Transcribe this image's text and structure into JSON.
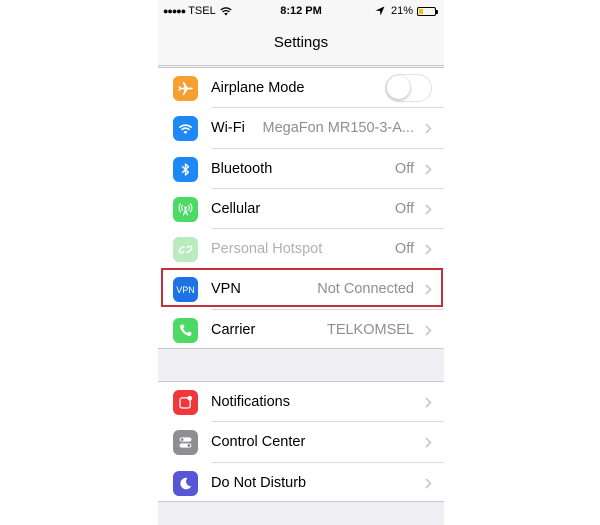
{
  "status_bar": {
    "signal": "●●●●●",
    "carrier": "TSEL",
    "time": "8:12 PM",
    "battery": "21%",
    "battery_level": 0.21
  },
  "nav": {
    "title": "Settings"
  },
  "colors": {
    "airplane": "#f7a032",
    "wifi": "#1e88f5",
    "bluetooth": "#1e88f5",
    "cellular": "#4cd964",
    "hotspot": "#b9ebbf",
    "vpn": "#1e72e8",
    "carrier": "#4cd964",
    "notifications": "#f0383a",
    "control_center": "#8e8e93",
    "dnd": "#5856d6",
    "highlight": "#c5303a"
  },
  "group1": [
    {
      "label": "Airplane Mode",
      "icon": "airplane-icon",
      "toggle": false
    },
    {
      "label": "Wi-Fi",
      "value": "MegaFon MR150-3-A...",
      "icon": "wifi-icon"
    },
    {
      "label": "Bluetooth",
      "value": "Off",
      "icon": "bluetooth-icon"
    },
    {
      "label": "Cellular",
      "value": "Off",
      "icon": "cellular-icon"
    },
    {
      "label": "Personal Hotspot",
      "value": "Off",
      "icon": "hotspot-icon"
    },
    {
      "label": "VPN",
      "value": "Not Connected",
      "icon": "vpn-icon",
      "icon_text": "VPN"
    },
    {
      "label": "Carrier",
      "value": "TELKOMSEL",
      "icon": "phone-icon"
    }
  ],
  "group2": [
    {
      "label": "Notifications",
      "icon": "notifications-icon"
    },
    {
      "label": "Control Center",
      "icon": "control-center-icon"
    },
    {
      "label": "Do Not Disturb",
      "icon": "moon-icon"
    }
  ]
}
